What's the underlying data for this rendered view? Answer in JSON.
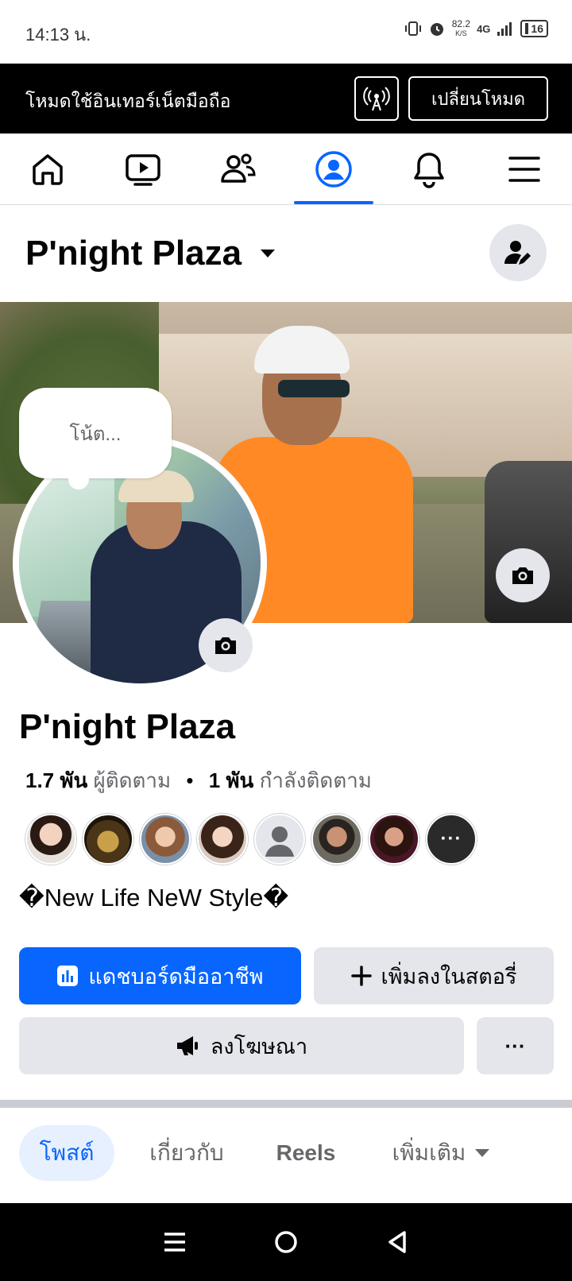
{
  "status_bar": {
    "time": "14:13 น.",
    "speed_value": "82.2",
    "speed_unit": "K/S",
    "network": "4G",
    "battery": "16"
  },
  "banner": {
    "text": "โหมดใช้อินเทอร์เน็ตมือถือ",
    "switch_label": "เปลี่ยนโหมด"
  },
  "nav": {
    "tabs": [
      "home-icon",
      "video-icon",
      "friends-icon",
      "profile-icon",
      "bell-icon",
      "menu-icon"
    ],
    "active_tab": "profile-icon",
    "accent_color": "#0866ff"
  },
  "header": {
    "name": "P'night Plaza"
  },
  "note": {
    "placeholder": "โน้ต..."
  },
  "profile": {
    "name": "P'night Plaza",
    "followers_count": "1.7 พัน",
    "followers_label": "ผู้ติดตาม",
    "separator": "•",
    "following_count": "1 พัน",
    "following_label": "กำลังติดตาม",
    "bio": "�New Life NeW Style�"
  },
  "friends": {
    "more_label": "···"
  },
  "actions": {
    "dashboard_label": "แดชบอร์ดมืออาชีพ",
    "add_story_label": "เพิ่มลงในสตอรี่",
    "advertise_label": "ลงโฆษณา",
    "more_label": "···"
  },
  "profile_tabs": {
    "posts": "โพสต์",
    "about": "เกี่ยวกับ",
    "reels": "Reels",
    "more": "เพิ่มเติม"
  }
}
